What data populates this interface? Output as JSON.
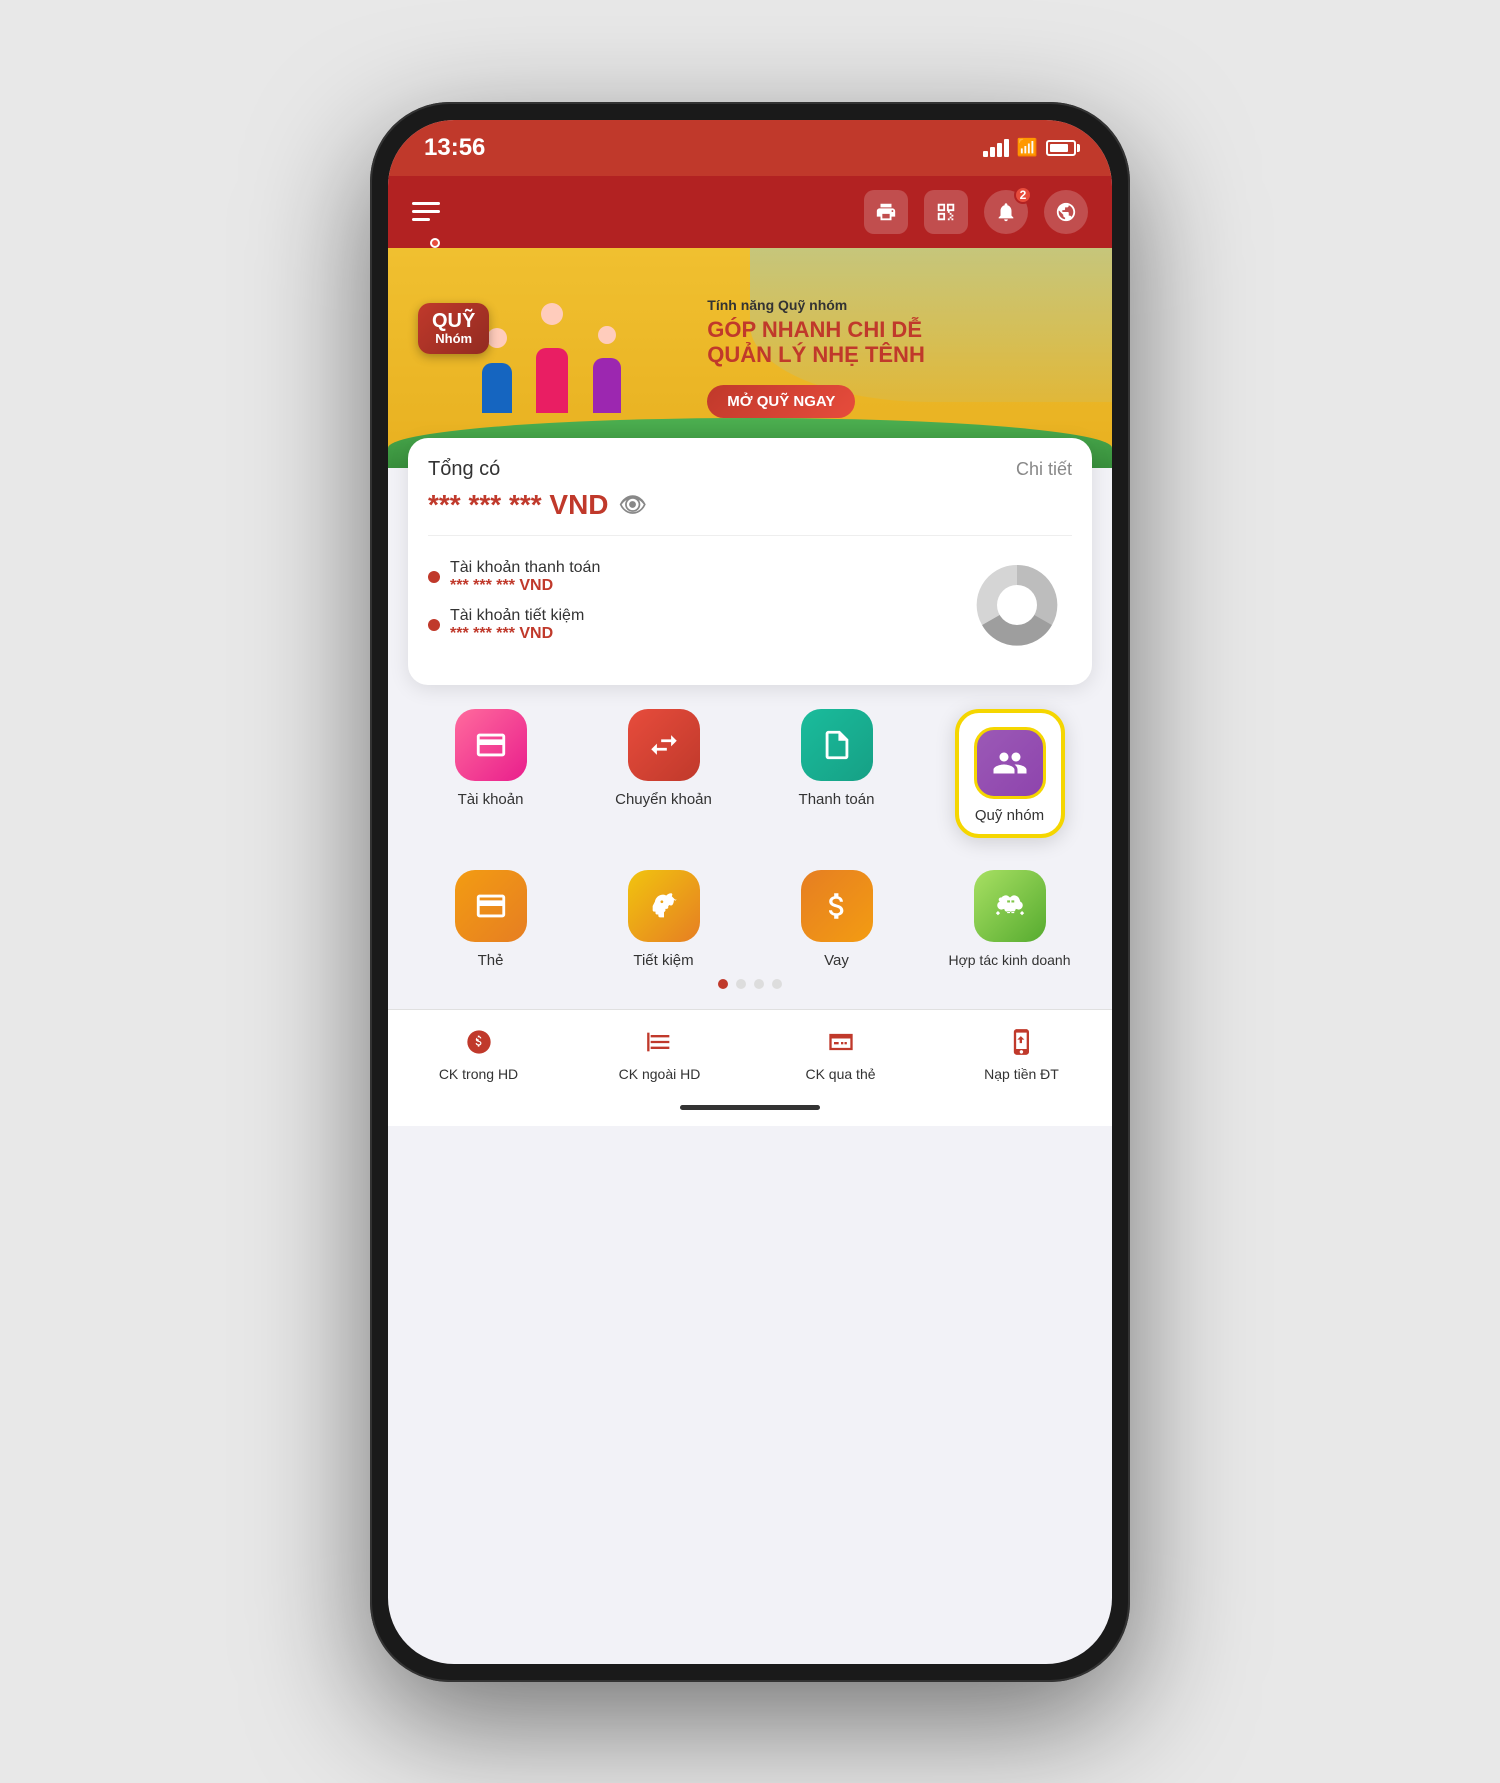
{
  "statusBar": {
    "time": "13:56"
  },
  "navBar": {
    "menuIcon": "≡"
  },
  "banner": {
    "badgeText": "QUỸ",
    "badgeSubText": "Nhóm",
    "smallTitle": "Tính năng Quỹ nhóm",
    "bigTitle1": "GÓP NHANH CHI DỄ",
    "bigTitle2": "QUẢN LÝ NHẸ TÊNH",
    "buttonText": "MỞ QUỸ NGAY"
  },
  "balance": {
    "label": "Tổng có",
    "detail": "Chi tiết",
    "amount": "*** *** *** VND",
    "items": [
      {
        "name": "Tài khoản thanh toán",
        "amount": "*** *** *** VND"
      },
      {
        "name": "Tài khoản tiết kiệm",
        "amount": "*** *** *** VND"
      }
    ]
  },
  "quickActions": {
    "row1": [
      {
        "label": "Tài khoản",
        "iconType": "pink",
        "icon": "💳"
      },
      {
        "label": "Chuyển khoản",
        "iconType": "red",
        "icon": "⇄"
      },
      {
        "label": "Thanh toán",
        "iconType": "teal",
        "icon": "📋"
      },
      {
        "label": "Quỹ nhóm",
        "iconType": "purple",
        "icon": "👥"
      }
    ],
    "row2": [
      {
        "label": "Thẻ",
        "iconType": "orange",
        "icon": "💳"
      },
      {
        "label": "Tiết kiệm",
        "iconType": "yellow",
        "icon": "🐷"
      },
      {
        "label": "Vay",
        "iconType": "orange2",
        "icon": "💰"
      },
      {
        "label": "Hợp tác kinh doanh",
        "iconType": "green",
        "icon": "🤝"
      }
    ]
  },
  "pageDots": [
    true,
    false,
    false,
    false
  ],
  "bottomNav": [
    {
      "label": "CK trong HD",
      "icon": "💲"
    },
    {
      "label": "CK ngoài HD",
      "icon": "🏛"
    },
    {
      "label": "CK qua thẻ",
      "icon": "▦"
    },
    {
      "label": "Nạp tiền ĐT",
      "icon": "📱"
    }
  ]
}
